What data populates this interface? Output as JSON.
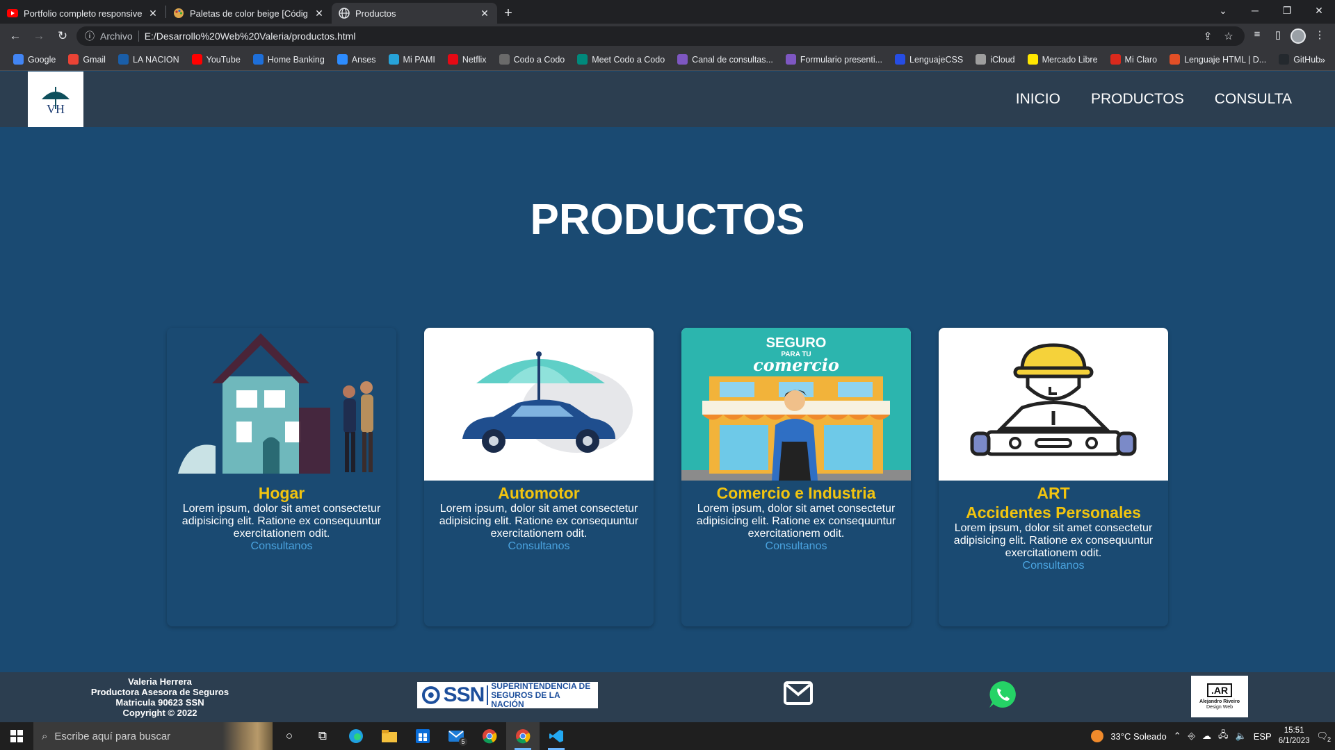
{
  "browser": {
    "tabs": [
      {
        "title": "Portfolio completo responsive - F",
        "icon": "youtube-icon"
      },
      {
        "title": "Paletas de color beige [Códigos",
        "icon": "palette-icon"
      },
      {
        "title": "Productos",
        "icon": "globe-icon",
        "active": true
      }
    ],
    "address": {
      "scheme_label": "Archivo",
      "url": "E:/Desarrollo%20Web%20Valeria/productos.html"
    },
    "bookmarks": [
      {
        "label": "Google",
        "color": "#4285f4"
      },
      {
        "label": "Gmail",
        "color": "#ea4335"
      },
      {
        "label": "LA NACION",
        "color": "#1a5ea8"
      },
      {
        "label": "YouTube",
        "color": "#ff0000"
      },
      {
        "label": "Home Banking",
        "color": "#1e6fd9"
      },
      {
        "label": "Anses",
        "color": "#2d8cff"
      },
      {
        "label": "Mi PAMI",
        "color": "#27a3d9"
      },
      {
        "label": "Netflix",
        "color": "#e50914"
      },
      {
        "label": "Codo a Codo",
        "color": "#6a6a6a"
      },
      {
        "label": "Meet Codo a Codo",
        "color": "#00897b"
      },
      {
        "label": "Canal de consultas...",
        "color": "#7e57c2"
      },
      {
        "label": "Formulario presenti...",
        "color": "#7e57c2"
      },
      {
        "label": "LenguajeCSS",
        "color": "#264de4"
      },
      {
        "label": "iCloud",
        "color": "#9e9e9e"
      },
      {
        "label": "Mercado Libre",
        "color": "#ffe600"
      },
      {
        "label": "Mi Claro",
        "color": "#da291c"
      },
      {
        "label": "Lenguaje HTML | D...",
        "color": "#e34f26"
      },
      {
        "label": "GitHub",
        "color": "#24292e"
      }
    ]
  },
  "site": {
    "logo_text": "VH",
    "nav": [
      "INICIO",
      "PRODUCTOS",
      "CONSULTA"
    ],
    "page_title": "PRODUCTOS",
    "banner_text": "SEGURO PARA TU comercio",
    "cards": [
      {
        "title": "Hogar",
        "subtitle": "",
        "body": "Lorem ipsum, dolor sit amet consectetur adipisicing elit. Ratione ex consequuntur exercitationem odit.",
        "link": "Consultanos"
      },
      {
        "title": "Automotor",
        "subtitle": "",
        "body": "Lorem ipsum, dolor sit amet consectetur adipisicing elit. Ratione ex consequuntur exercitationem odit.",
        "link": "Consultanos"
      },
      {
        "title": "Comercio e Industria",
        "subtitle": "",
        "body": "Lorem ipsum, dolor sit amet consectetur adipisicing elit. Ratione ex consequuntur exercitationem odit.",
        "link": "Consultanos"
      },
      {
        "title": "ART",
        "subtitle": "Accidentes Personales",
        "body": "Lorem ipsum, dolor sit amet consectetur adipisicing elit. Ratione ex consequuntur exercitationem odit.",
        "link": "Consultanos"
      }
    ],
    "footer": {
      "lines": [
        "Valeria Herrera",
        "Productora Asesora de Seguros",
        "Matricula 90623 SSN",
        "Copyright © 2022"
      ],
      "ssn_logo": "SSN",
      "ssn_text": [
        "SUPERINTENDENCIA DE",
        "SEGUROS DE LA NACIÓN"
      ],
      "badge": [
        ".AR",
        "Alejandro Riveiro",
        "Design Web"
      ]
    }
  },
  "taskbar": {
    "search_placeholder": "Escribe aquí para buscar",
    "mail_badge": "5",
    "weather": "33°C  Soleado",
    "lang": "ESP",
    "time": "15:51",
    "date": "6/1/2023",
    "notif_count": "2"
  },
  "colors": {
    "accent": "#f2c40f",
    "link": "#4aa3df",
    "header": "#2c3e50",
    "page_bg": "#1a4a72"
  }
}
